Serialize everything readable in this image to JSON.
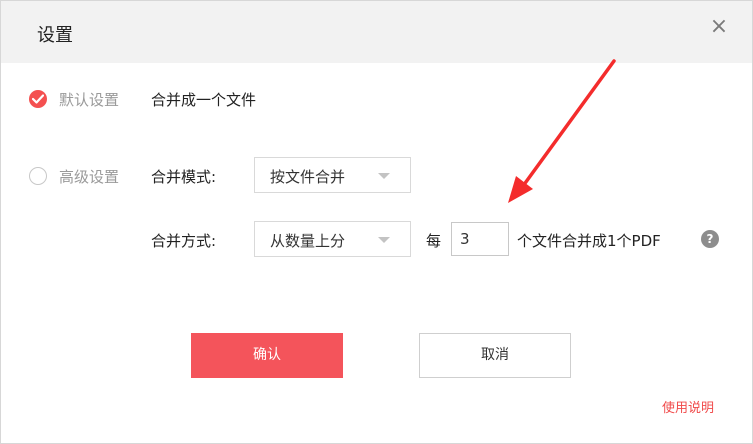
{
  "dialog": {
    "title": "设置",
    "close_icon": "close-icon",
    "close_glyph": "×"
  },
  "default_setting": {
    "label": "默认设置",
    "checked": true,
    "description": "合并成一个文件"
  },
  "advanced_setting": {
    "label": "高级设置",
    "checked": false,
    "merge_mode_label": "合并模式:",
    "merge_mode_value": "按文件合并",
    "merge_method_label": "合并方式:",
    "merge_method_value": "从数量上分",
    "per_label": "每",
    "count_value": "3",
    "suffix": "个文件合并成1个PDF",
    "help_icon": "question-icon",
    "help_glyph": "?"
  },
  "buttons": {
    "confirm": "确认",
    "cancel": "取消"
  },
  "help_link": "使用说明",
  "colors": {
    "accent": "#f4545b",
    "link": "#f04a4a",
    "header_bg": "#f2f2f2",
    "annotation_arrow": "#f42c2c"
  }
}
